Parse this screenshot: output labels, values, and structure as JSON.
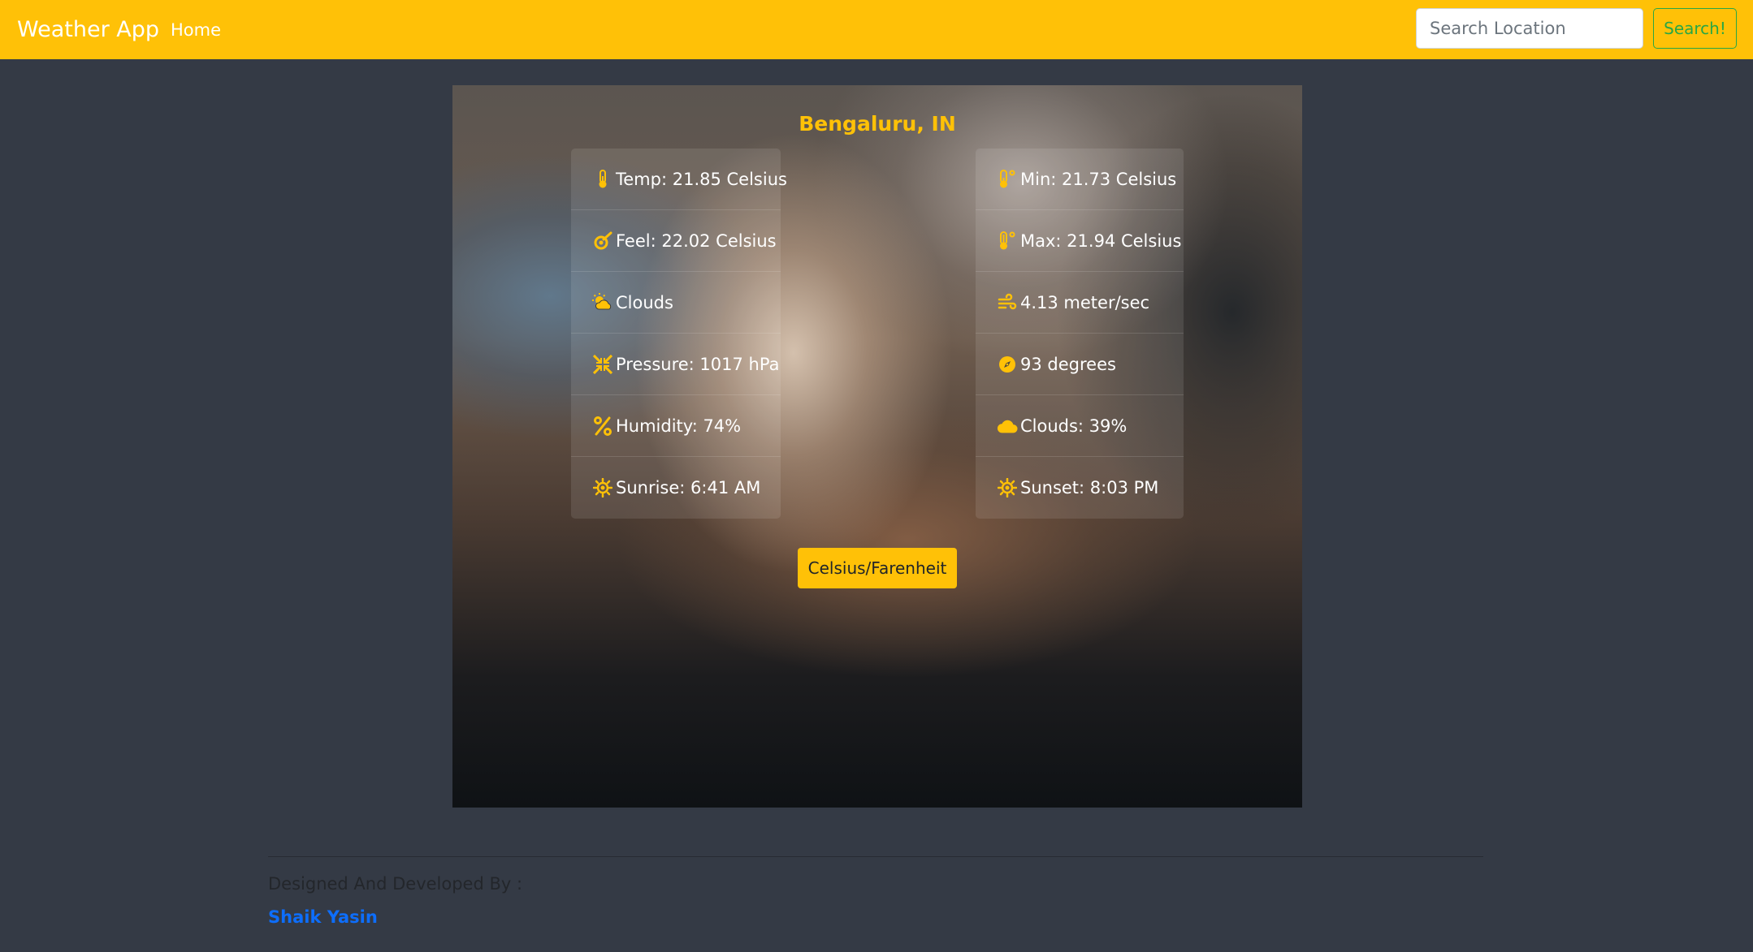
{
  "navbar": {
    "brand": "Weather App",
    "home_label": "Home",
    "search_placeholder": "Search Location",
    "search_value": "",
    "search_button_label": "Search!"
  },
  "weather": {
    "location": "Bengaluru, IN",
    "left_column": [
      {
        "icon": "thermometer-icon",
        "text": "Temp: 21.85 Celsius"
      },
      {
        "icon": "feels-like-icon",
        "text": "Feel: 22.02 Celsius"
      },
      {
        "icon": "cloud-sun-icon",
        "text": "Clouds"
      },
      {
        "icon": "compress-icon",
        "text": "Pressure: 1017 hPa"
      },
      {
        "icon": "percent-icon",
        "text": "Humidity: 74%"
      },
      {
        "icon": "sun-icon",
        "text": "Sunrise: 6:41 AM"
      }
    ],
    "right_column": [
      {
        "icon": "temperature-low-icon",
        "text": "Min: 21.73 Celsius"
      },
      {
        "icon": "temperature-high-icon",
        "text": "Max: 21.94 Celsius"
      },
      {
        "icon": "wind-icon",
        "text": "4.13 meter/sec"
      },
      {
        "icon": "compass-icon",
        "text": "93 degrees"
      },
      {
        "icon": "cloud-icon",
        "text": "Clouds: 39%"
      },
      {
        "icon": "sun-icon",
        "text": "Sunset: 8:03 PM"
      }
    ],
    "toggle_label": "Celsius/Farenheit"
  },
  "footer": {
    "designed_by": "Designed And Developed By :",
    "author": "Shaik Yasin"
  },
  "colors": {
    "navbar": "#ffc107",
    "accent": "#ffc107",
    "search_button": "#28a745",
    "page_background": "#343a45",
    "author_link": "#0d6efd"
  }
}
